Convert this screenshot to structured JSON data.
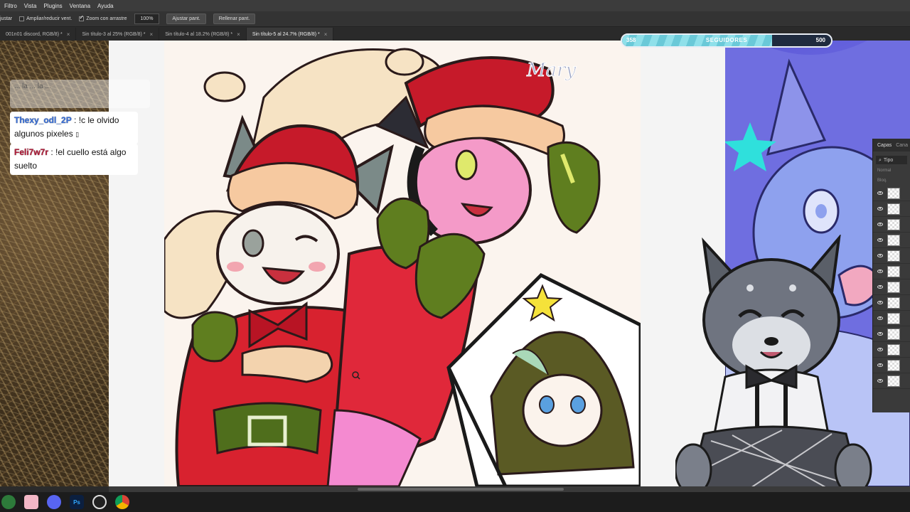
{
  "menu": [
    "Filtro",
    "Vista",
    "Plugins",
    "Ventana",
    "Ayuda"
  ],
  "options": {
    "left_text": "justar",
    "resize_windows": "Ampliar/reducir vent.",
    "scrubby_zoom": "Zoom con arrastre",
    "zoom_value": "100%",
    "fit_screen": "Ajustar pant.",
    "fill_screen": "Rellenar pant."
  },
  "tabs": [
    {
      "label": "001n01 discord, RGB/8) *"
    },
    {
      "label": "Sin título-3 al 25% (RGB/8) *"
    },
    {
      "label": "Sin título-4 al 18.2% (RGB/8) *"
    },
    {
      "label": "Sin título-5 al 24.7% (RGB/8) *"
    }
  ],
  "chat": {
    "ghost": "... la ... la ...",
    "messages": [
      {
        "user": "Thexy_odl_2P",
        "sep": ":",
        "text": " !c le olvido algunos pixeles ",
        "emoji_glyph": "▯"
      },
      {
        "user": "Feli7w7r",
        "sep": ":",
        "text": " !el cuello está algo suelto"
      }
    ]
  },
  "followers": {
    "current": "358",
    "label": "SEGUIDORES",
    "goal": "500",
    "progress_fraction": 0.716
  },
  "watermark": "Mary",
  "layers_panel": {
    "tab_layers": "Capas",
    "tab_channels": "Cana",
    "search": "Tipo",
    "mode": "Normal",
    "lock": "Bloq.",
    "layer_count": 13
  },
  "colors": {
    "accent_teal": "#6ac9d8",
    "santa_red": "#d8222f",
    "glove_green": "#6a8a1f"
  }
}
